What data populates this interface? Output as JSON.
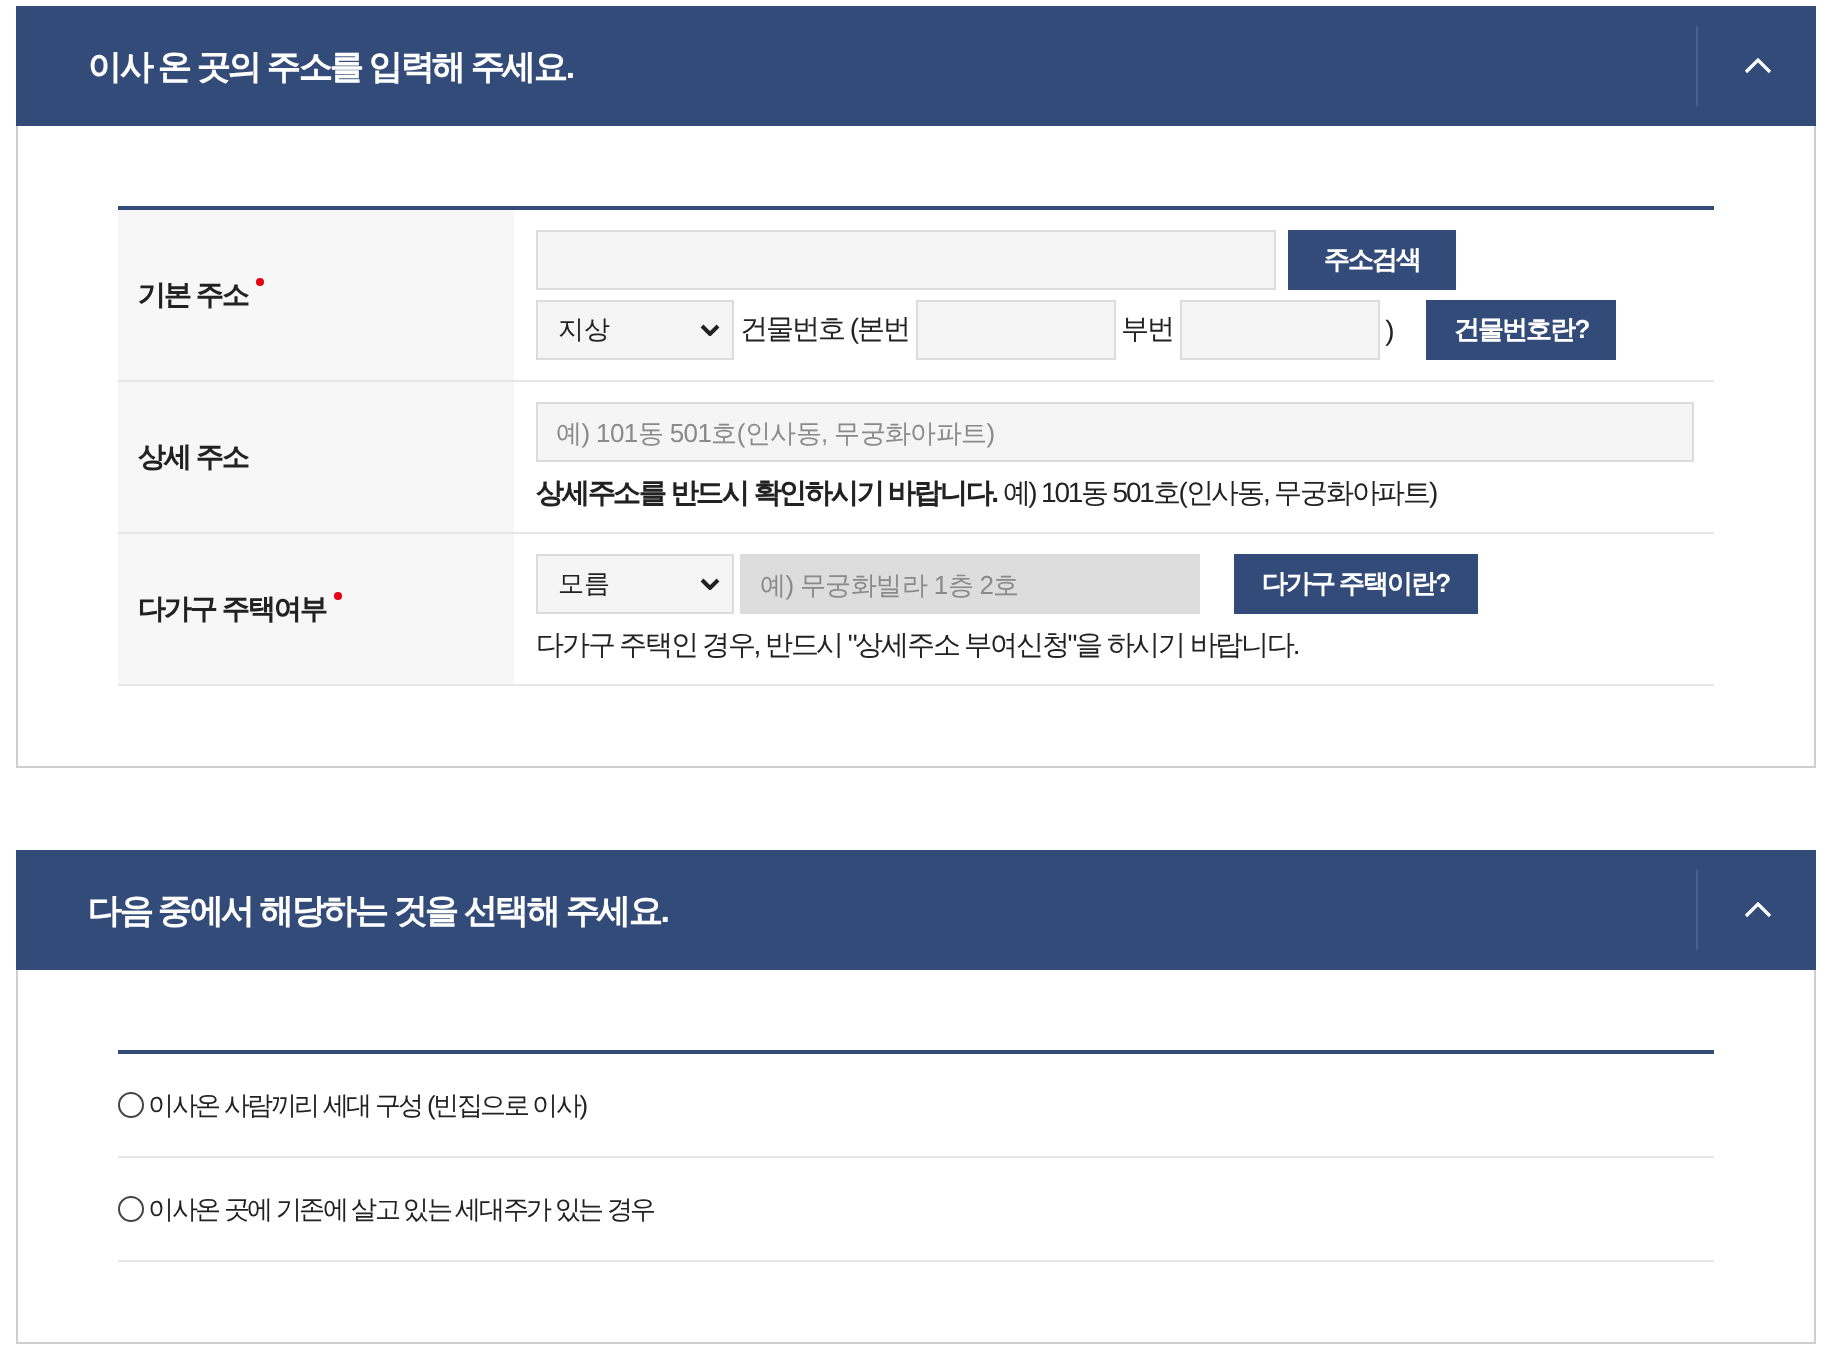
{
  "sections": [
    {
      "kind": "form",
      "title": "이사 온 곳의 주소를 입력해 주세요.",
      "expanded": true,
      "rows": [
        {
          "label": "기본 주소",
          "required": true,
          "lines": [
            [
              {
                "kind": "search_input",
                "disabled": false
              },
              {
                "kind": "search_button",
                "text": "주소검색"
              }
            ],
            [
              {
                "kind": "select",
                "value": "지상"
              },
              {
                "kind": "label",
                "text": "건물번호 (본번"
              },
              {
                "kind": "number_input",
                "disabled": false
              },
              {
                "kind": "label",
                "text": "부번"
              },
              {
                "kind": "number_input",
                "disabled": false
              },
              {
                "kind": "label",
                "text": ")"
              },
              {
                "kind": "help_button",
                "text": "건물번호란?"
              }
            ]
          ]
        },
        {
          "label": "상세 주소",
          "required": false,
          "lines": [
            [
              {
                "kind": "full_input",
                "placeholder": "예) 101동 501호(인사동, 무궁화아파트)",
                "disabled": false
              }
            ],
            [
              {
                "kind": "note",
                "text": "**상세주소를 반드시 확인하시기 바랍니다.** 예) 101동 501호(인사동, 무궁화아파트)"
              }
            ]
          ]
        },
        {
          "label": "다가구 주택여부",
          "required": true,
          "lines": [
            [
              {
                "kind": "select",
                "value": "모름"
              },
              {
                "kind": "input",
                "placeholder": "예) 무궁화빌라 1층 2호",
                "disabled": true
              },
              {
                "kind": "help_button",
                "text": "다가구 주택이란?"
              }
            ],
            [
              {
                "kind": "note",
                "text": "다가구 주택인 경우, 반드시 \"상세주소 부여신청\"을 하시기 바랍니다."
              }
            ]
          ]
        }
      ]
    },
    {
      "kind": "choices",
      "title": "다음 중에서 해당하는 것을 선택해 주세요.",
      "expanded": true,
      "options": [
        {
          "label": "이사온 사람끼리 세대 구성 (빈집으로 이사)",
          "selected": false
        },
        {
          "label": "이사온 곳에 기존에 살고 있는 세대주가 있는 경우",
          "selected": false
        }
      ]
    }
  ]
}
